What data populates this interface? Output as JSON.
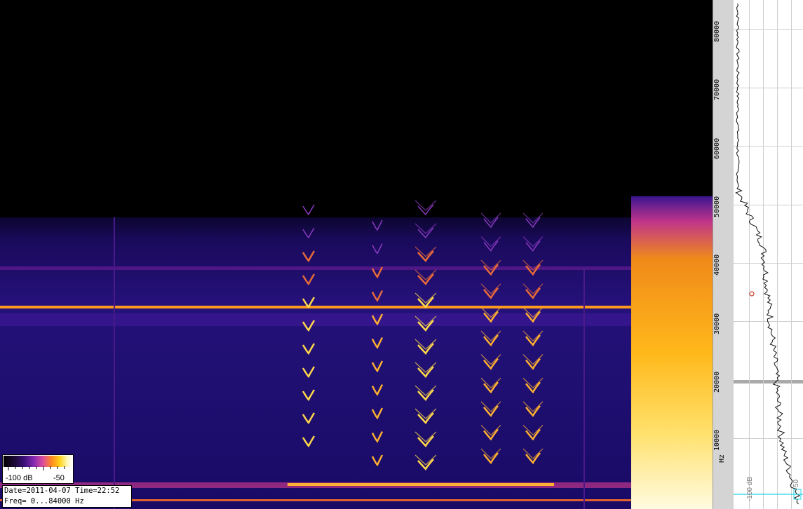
{
  "info": {
    "date_line": "Date=2011-04-07 Time=22:52",
    "freq_line": "Freq= 0...84000 Hz"
  },
  "legend": {
    "min_label": "-100 dB",
    "max_label": "-50"
  },
  "freq_axis": {
    "unit": "Hz",
    "ticks": [
      "80000",
      "70000",
      "60000",
      "50000",
      "40000",
      "30000",
      "20000",
      "10000"
    ]
  },
  "spectrum_axis": {
    "labels": [
      "-100 dB",
      "-50"
    ]
  },
  "colors": {
    "background": "#000000",
    "noise": "#1c0f6e",
    "hum": "#ff9a1f",
    "bright": "#ffe27a",
    "cursor": "#27d3e6",
    "marker": "#c8381e"
  }
}
